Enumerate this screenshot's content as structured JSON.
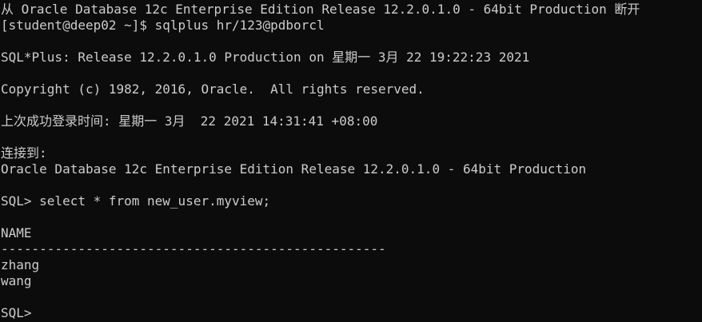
{
  "window": {
    "background": "#0c0c0c",
    "foreground": "#cccccc"
  },
  "lines": [
    "从 Oracle Database 12c Enterprise Edition Release 12.2.0.1.0 - 64bit Production 断开",
    "[student@deep02 ~]$ sqlplus hr/123@pdborcl",
    "",
    "SQL*Plus: Release 12.2.0.1.0 Production on 星期一 3月 22 19:22:23 2021",
    "",
    "Copyright (c) 1982, 2016, Oracle.  All rights reserved.",
    "",
    "上次成功登录时间: 星期一 3月  22 2021 14:31:41 +08:00",
    "",
    "连接到:",
    "Oracle Database 12c Enterprise Edition Release 12.2.0.1.0 - 64bit Production",
    "",
    "SQL> select * from new_user.myview;",
    "",
    "NAME",
    "--------------------------------------------------",
    "zhang",
    "wang",
    "",
    "SQL> "
  ]
}
